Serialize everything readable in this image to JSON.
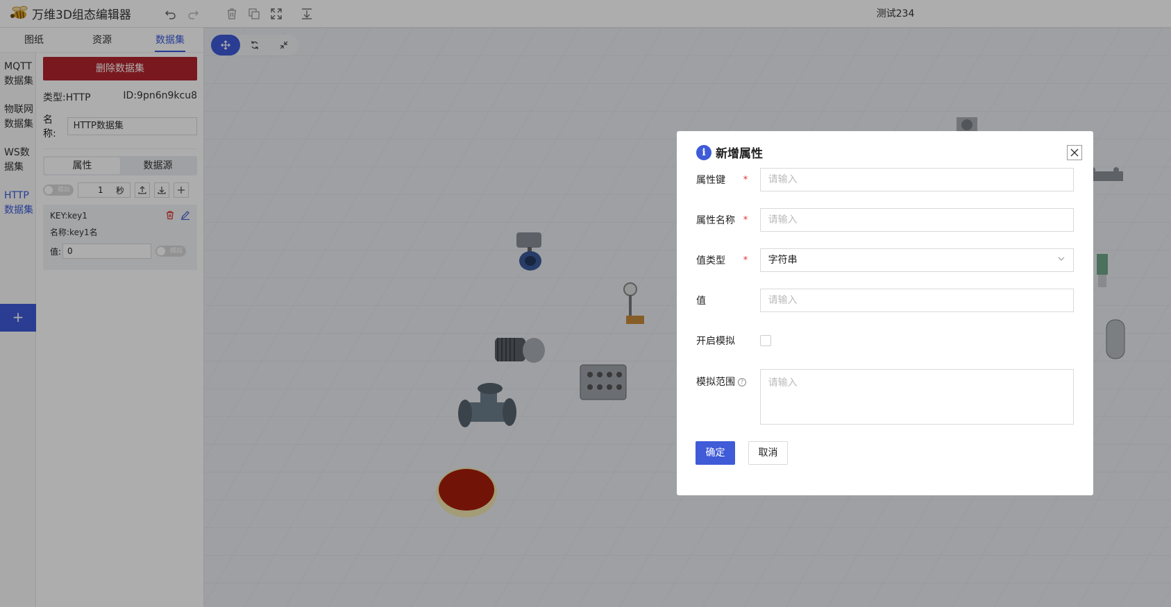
{
  "app": {
    "title": "万维3D组态编辑器",
    "doc_title": "测试234"
  },
  "left": {
    "tabs": [
      "图纸",
      "资源",
      "数据集"
    ],
    "active_tab": "数据集",
    "datasets": [
      "MQTT数据集",
      "物联网数据集",
      "WS数据集",
      "HTTP数据集"
    ],
    "add_label": "+",
    "delete_label": "删除数据集",
    "type_text": "类型:HTTP",
    "id_text": "ID:9pn6n9kcu8",
    "name_label": "名称:",
    "name_value": "HTTP数据集",
    "sub_tabs": [
      "属性",
      "数据源"
    ],
    "toggle_label": "模拟",
    "interval_value": "1",
    "interval_unit": "秒",
    "property": {
      "key": "KEY:key1",
      "name": "名称:key1名",
      "value_label": "值:",
      "value": "0",
      "toggle_label": "模拟"
    }
  },
  "modal": {
    "title": "新增属性",
    "fields": [
      {
        "label": "属性键",
        "required": "*",
        "placeholder": "请输入"
      },
      {
        "label": "属性名称",
        "required": "*",
        "placeholder": "请输入"
      },
      {
        "label": "值类型",
        "required": "*",
        "value": "字符串"
      },
      {
        "label": "值",
        "placeholder": "请输入"
      },
      {
        "label": "开启模拟"
      },
      {
        "label": "模拟范围",
        "placeholder": "请输入"
      }
    ],
    "confirm_label": "确定",
    "cancel_label": "取消"
  },
  "colors": {
    "accent": "#3f5bd8",
    "danger": "#b3262e",
    "required": "#d33333"
  }
}
